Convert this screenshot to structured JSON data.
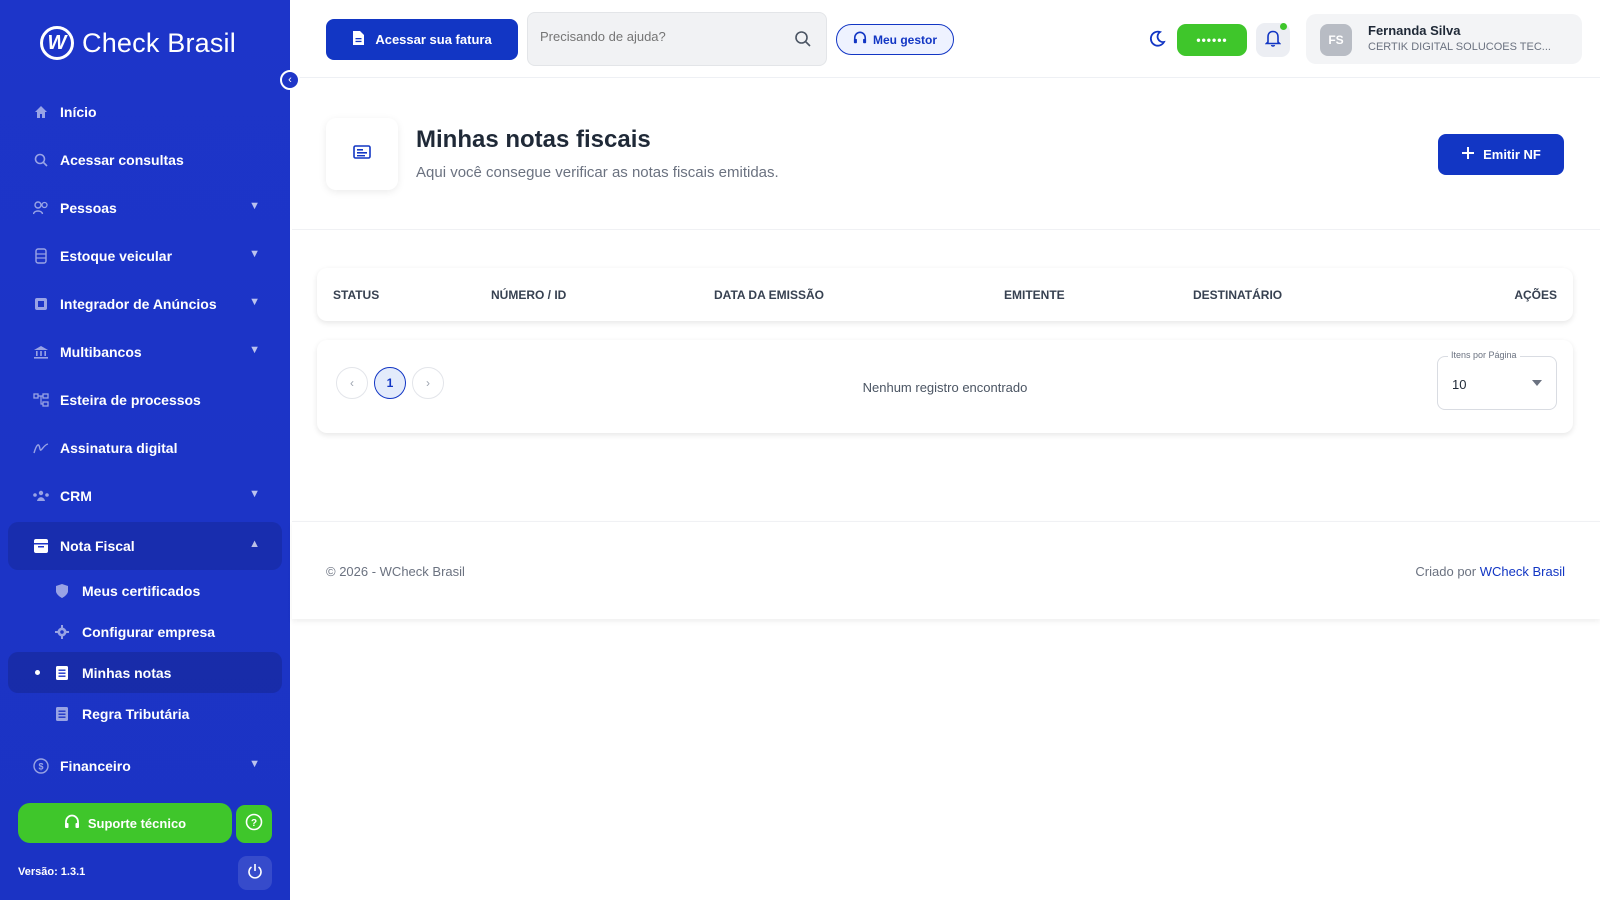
{
  "brand": {
    "name": "Check Brasil"
  },
  "sidebar": {
    "items": [
      {
        "label": "Início",
        "icon": "home-icon",
        "has_chevron": false
      },
      {
        "label": "Acessar consultas",
        "icon": "search-icon",
        "has_chevron": false
      },
      {
        "label": "Pessoas",
        "icon": "people-icon",
        "has_chevron": true
      },
      {
        "label": "Estoque veicular",
        "icon": "car-icon",
        "has_chevron": true
      },
      {
        "label": "Integrador de Anúncios",
        "icon": "ads-icon",
        "has_chevron": true
      },
      {
        "label": "Multibancos",
        "icon": "bank-icon",
        "has_chevron": true
      },
      {
        "label": "Esteira de processos",
        "icon": "flow-icon",
        "has_chevron": true
      },
      {
        "label": "Assinatura digital",
        "icon": "signature-icon",
        "has_chevron": false
      },
      {
        "label": "CRM",
        "icon": "crm-icon",
        "has_chevron": true
      }
    ],
    "open_group": {
      "label": "Nota Fiscal",
      "icon": "invoice-icon",
      "children": [
        {
          "label": "Meus certificados",
          "icon": "certificate-icon"
        },
        {
          "label": "Configurar empresa",
          "icon": "gear-icon"
        },
        {
          "label": "Minhas notas",
          "icon": "list-icon",
          "active": true
        },
        {
          "label": "Regra Tributária",
          "icon": "rule-icon"
        }
      ]
    },
    "after_items": [
      {
        "label": "Financeiro",
        "icon": "money-icon",
        "has_chevron": true
      }
    ],
    "support_label": "Suporte técnico",
    "version": "Versão: 1.3.1"
  },
  "topbar": {
    "invoice_button": "Acessar sua fatura",
    "search_placeholder": "Precisando de ajuda?",
    "manager_button": "Meu gestor",
    "status_pill": "••••••",
    "user": {
      "initials": "FS",
      "name": "Fernanda Silva",
      "company": "CERTIK DIGITAL SOLUCOES TEC..."
    }
  },
  "page": {
    "title": "Minhas notas fiscais",
    "subtitle": "Aqui você consegue verificar as notas fiscais emitidas.",
    "emit_button": "Emitir NF"
  },
  "table": {
    "columns": [
      "STATUS",
      "NÚMERO / ID",
      "DATA DA EMISSÃO",
      "EMITENTE",
      "DESTINATÁRIO",
      "AÇÕES"
    ],
    "empty_message": "Nenhum registro encontrado",
    "current_page": "1",
    "per_page_label": "Itens por Página",
    "per_page_value": "10"
  },
  "footer": {
    "copyright": "© 2026 - WCheck Brasil",
    "credit_prefix": "Criado por",
    "credit_link": "WCheck Brasil"
  },
  "colors": {
    "primary": "#1236c4",
    "sidebar": "#1f36c8",
    "accent_green": "#3fc62b"
  }
}
